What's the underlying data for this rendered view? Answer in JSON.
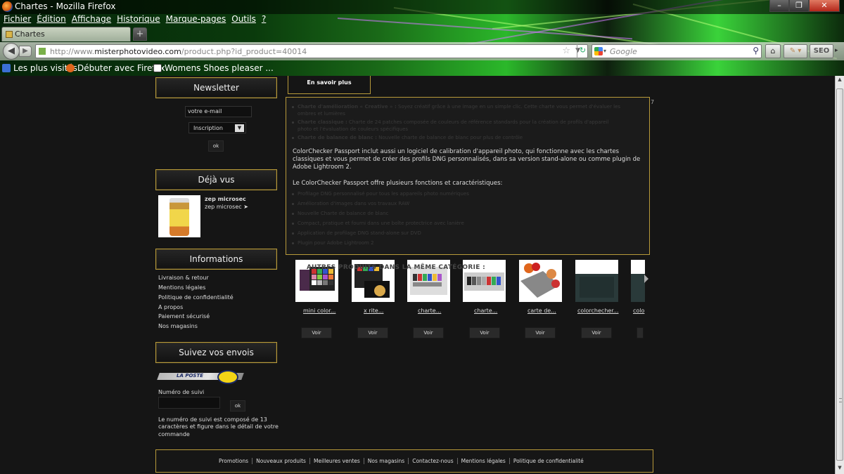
{
  "browser": {
    "window_title": "Chartes - Mozilla Firefox",
    "menu": [
      "Fichier",
      "Édition",
      "Affichage",
      "Historique",
      "Marque-pages",
      "Outils",
      "?"
    ],
    "tab_label": "Chartes",
    "new_tab": "+",
    "url_host": "http://www.",
    "url_domain": "misterphotovideo.com",
    "url_path": "/product.php?id_product=40014",
    "search_placeholder": "Google",
    "tool_seo": "SEO",
    "bookmarks": [
      "Les plus visités",
      "Débuter avec Firefox",
      "Womens Shoes pleaser ..."
    ]
  },
  "sidebar": {
    "newsletter": {
      "title": "Newsletter",
      "email_placeholder": "votre e-mail",
      "select_value": "Inscription",
      "ok": "ok"
    },
    "deja_vus": {
      "title": "Déjà vus",
      "product_name": "zep microsec",
      "product_link": "zep microsec ➤"
    },
    "informations": {
      "title": "Informations",
      "links": [
        "Livraison & retour",
        "Mentions légales",
        "Politique de confidentialité",
        "A propos",
        "Paiement sécurisé",
        "Nos magasins"
      ]
    },
    "suivi": {
      "title": "Suivez vos envois",
      "laposte": "LA POSTE",
      "label": "Numéro de suivi",
      "ok": "ok",
      "note_lines": [
        "Le numéro de suivi est composé de 13",
        "caractères et figure dans le détail de votre",
        "commande"
      ]
    }
  },
  "main": {
    "en_savoir_plus": "En savoir plus",
    "faint_items_1": [
      {
        "bold": "Charte d'amélioration « Creative » :",
        "text": " Soyez créatif grâce à une image en un simple clic. Cette charte vous permet d'évaluer les"
      },
      {
        "bold": "",
        "text": "ombres et lumières"
      },
      {
        "bold": "Charte classique :",
        "text": " Charte de 24 patches composée de couleurs de référence standards pour la création de profils d'appareil"
      },
      {
        "bold": "",
        "text": "photo et l'évaluation de couleurs spécifiques"
      },
      {
        "bold": "Charte de balance de blanc :",
        "text": " Nouvelle charte de balance de blanc pour plus de contrôle"
      }
    ],
    "paragraph_1": [
      "ColorChecker Passport inclut aussi un logiciel de calibration d'appareil photo, qui fonctionne avec les chartes",
      "classiques et vous permet de créer des profils DNG personnalisés, dans sa version stand-alone ou comme plugin de",
      "Adobe Lightroom 2."
    ],
    "paragraph_2": "Le ColorChecker Passport offre plusieurs fonctions et caractéristiques:",
    "faint_items_2": [
      "Profilage DNG personnalisé pour tous les appareils photo numériques",
      "Amélioration d'images dans vos travaux RAW",
      "Nouvelle Charte de balance de blanc",
      "Compact, pratique et fourni dans une boîte protectrice avec lanière",
      "Application de profilage DNG stand-alone sur DVD",
      "Plugin pour Adobe Lightroom 2"
    ],
    "seven": "7",
    "carousel_title": "AUTRES PRODUITS DANS LA MÊME CATÉGORIE :",
    "products": [
      {
        "label": "mini color...",
        "button": "Voir"
      },
      {
        "label": "x rite...",
        "button": "Voir"
      },
      {
        "label": "charte...",
        "button": "Voir"
      },
      {
        "label": "charte...",
        "button": "Voir"
      },
      {
        "label": "carte de...",
        "button": "Voir"
      },
      {
        "label": "colorchecher...",
        "button": "Voir"
      },
      {
        "label": "colo",
        "button": ""
      }
    ]
  },
  "footer": {
    "links": [
      "Promotions",
      "Nouveaux produits",
      "Meilleures ventes",
      "Nos magasins",
      "Contactez-nous",
      "Mentions légales",
      "Politique de confidentialité"
    ]
  },
  "colors": {
    "accent_border": "#b89a3a",
    "page_bg": "#151515"
  }
}
